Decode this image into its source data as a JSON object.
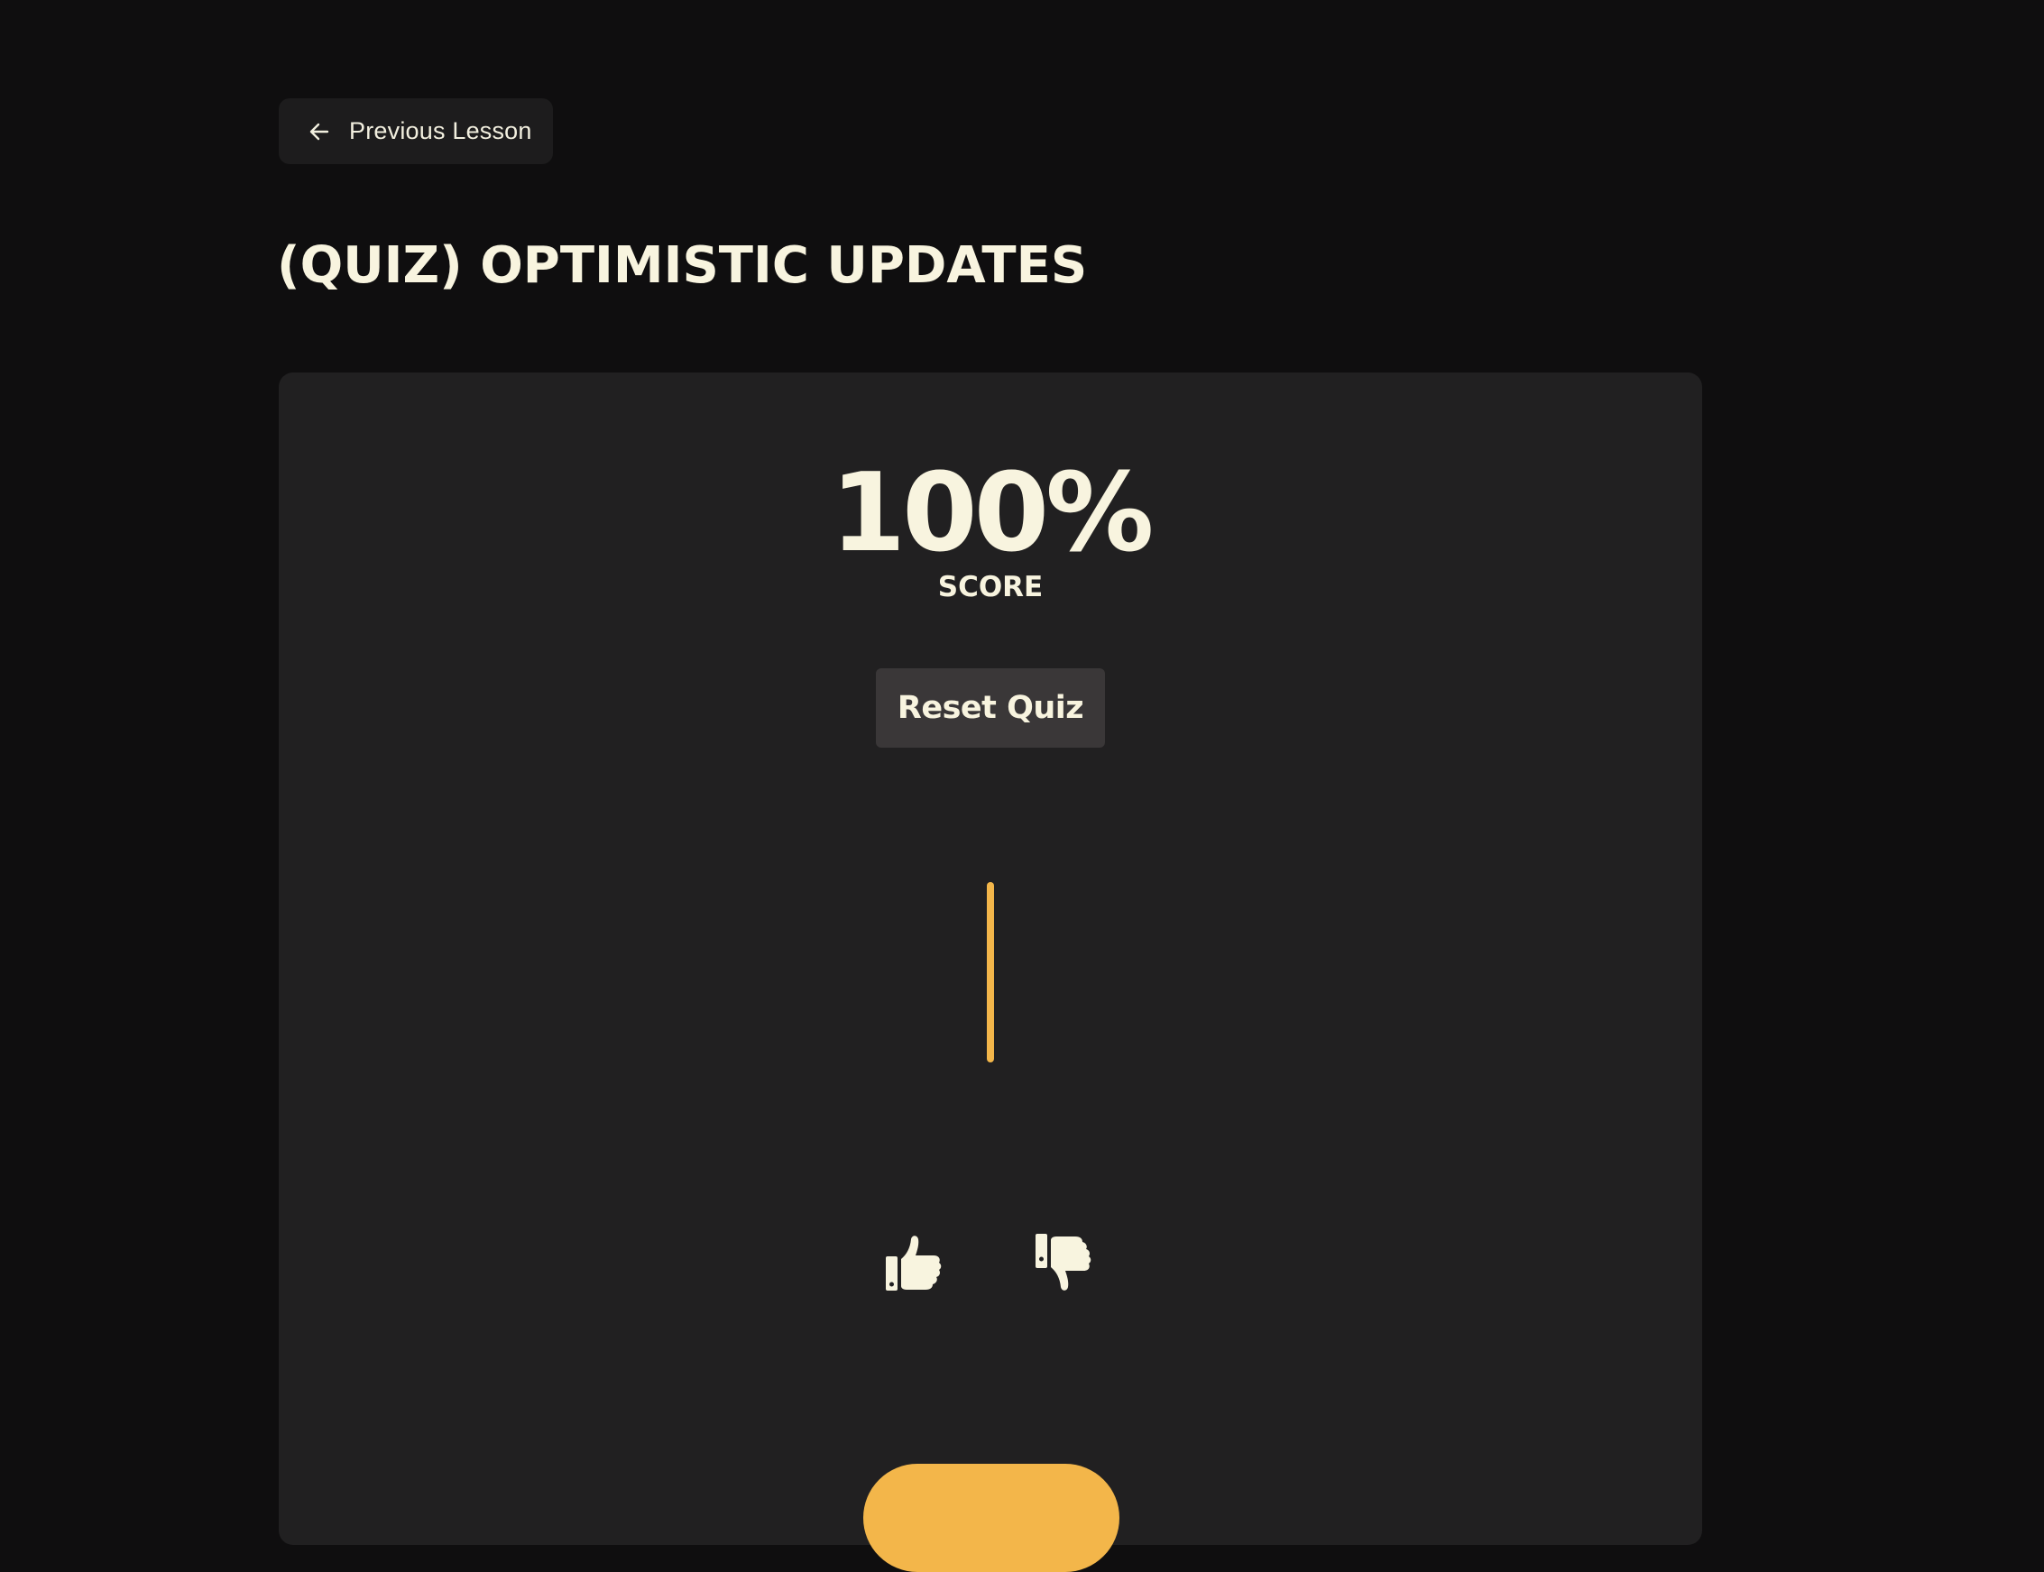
{
  "nav": {
    "previous_lesson_label": "Previous Lesson",
    "previous_icon": "arrow-left-icon"
  },
  "page": {
    "title": "(QUIZ) OPTIMISTIC UPDATES"
  },
  "quiz": {
    "score_value": "100%",
    "score_label": "SCORE",
    "reset_label": "Reset Quiz",
    "timer_icon": "timer-bar",
    "vote_up_icon": "thumbs-up-icon",
    "vote_down_icon": "thumbs-down-icon"
  },
  "colors": {
    "background": "#0f0e0f",
    "card": "#212021",
    "text": "#f8f4df",
    "accent": "#f3b64a",
    "button": "#3a3738"
  }
}
